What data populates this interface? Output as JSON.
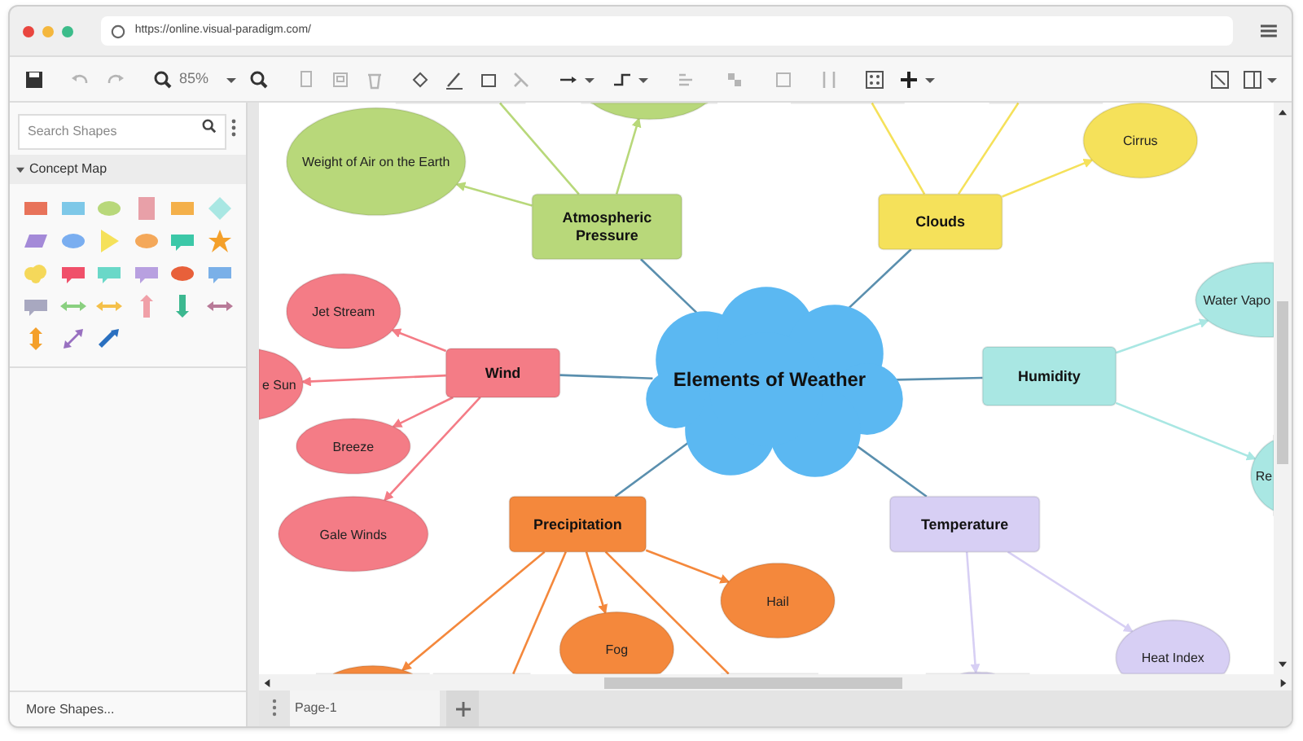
{
  "browser": {
    "url": "https://online.visual-paradigm.com/"
  },
  "toolbar": {
    "zoom": "85%"
  },
  "sidebar": {
    "search": {
      "placeholder": "Search Shapes"
    },
    "section": {
      "label": "Concept Map",
      "expanded": true
    },
    "footer": "More Shapes..."
  },
  "diagram": {
    "center": "Elements of Weather",
    "topics": [
      {
        "label": "Atmospheric Pressure",
        "color": "#b8d87a",
        "children": [
          {
            "kind": "labeled",
            "label": "Weight of Air on the Earth"
          },
          {
            "kind": "clipped"
          },
          {
            "kind": "clipped"
          }
        ]
      },
      {
        "label": "Clouds",
        "color": "#f5e15a",
        "children": [
          {
            "kind": "labeled",
            "label": "Cirrus"
          },
          {
            "kind": "clipped"
          },
          {
            "kind": "clipped"
          }
        ]
      },
      {
        "label": "Wind",
        "color": "#f47c86",
        "children": [
          {
            "kind": "labeled",
            "label": "Jet Stream"
          },
          {
            "kind": "labeled",
            "label": "e Sun"
          },
          {
            "kind": "labeled",
            "label": "Breeze"
          },
          {
            "kind": "labeled",
            "label": "Gale Winds"
          }
        ]
      },
      {
        "label": "Humidity",
        "color": "#a9e7e3",
        "children": [
          {
            "kind": "labeled",
            "label": "Water Vapo"
          },
          {
            "kind": "labeled",
            "label": "Re"
          }
        ]
      },
      {
        "label": "Precipitation",
        "color": "#f4883c",
        "children": [
          {
            "kind": "labeled",
            "label": "Hail"
          },
          {
            "kind": "labeled",
            "label": "Fog"
          },
          {
            "kind": "clipped"
          },
          {
            "kind": "clipped"
          },
          {
            "kind": "clipped"
          }
        ]
      },
      {
        "label": "Temperature",
        "color": "#d7cff4",
        "children": [
          {
            "kind": "labeled",
            "label": "Heat Index"
          },
          {
            "kind": "clipped"
          }
        ]
      }
    ]
  },
  "page_tabs": [
    {
      "label": "Page-1",
      "selected": true
    }
  ]
}
